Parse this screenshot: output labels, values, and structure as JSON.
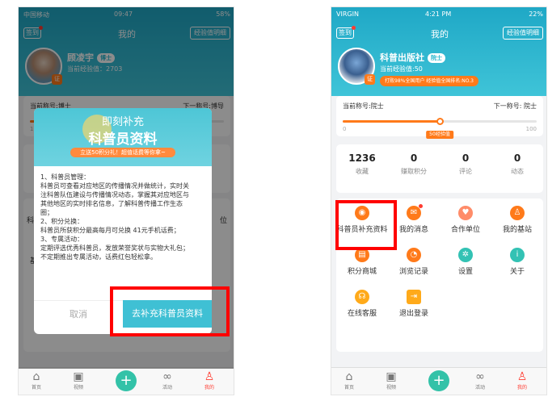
{
  "status": {
    "carrier_left": "中国移动",
    "time_left": "09:47",
    "battery_left": "58%",
    "carrier_right": "VIRGIN",
    "time_right": "4:21 PM",
    "battery_right": "22%"
  },
  "header": {
    "checkin_label": "签到",
    "title": "我的",
    "exp_detail_label": "经验值明细"
  },
  "left": {
    "user": {
      "name": "顾凌宇",
      "badge": "博士",
      "exp": "当前经验值：2703"
    },
    "level": {
      "current": "当前称号:博士",
      "next": "下一称号:博导",
      "min": "100"
    },
    "dialog": {
      "title1": "即刻补充",
      "title2": "科普员资料",
      "banner": "立送50积分礼！超值话费等你拿~",
      "lines": [
        "1、科普员管理：",
        "科普员可查看对应地区的传播情况并做统计，实时关",
        "注科普队伍建设与传播情况动态，掌握其对应地区与",
        "其他地区的实时排名信息，了解科普传播工作生态",
        "圈；",
        "2、积分兑换：",
        "科普员所获积分最高每月可兑换 41元手机话费；",
        "3、专属活动：",
        "定期评选优秀科普员，发放荣誉奖状与实物大礼包；",
        "不定期推出专属活动，话费红包轻松拿。"
      ],
      "cancel": "取消",
      "confirm": "去补充科普员资料"
    },
    "partial_left": "科普",
    "partial_left2": "基",
    "partial_right": "位"
  },
  "right": {
    "user": {
      "name": "科普出版社",
      "badge": "院士",
      "exp": "当前经验值:50",
      "rank": "打败98%全国用户 经验值全国排名:NO.3"
    },
    "level": {
      "current": "当前称号:院士",
      "next": "下一称号: 院士",
      "min": "0",
      "max": "100",
      "exp_badge": "50经验值",
      "progress": 0.5
    },
    "stats": [
      {
        "value": "1236",
        "label": "收藏"
      },
      {
        "value": "0",
        "label": "赚取积分"
      },
      {
        "value": "0",
        "label": "评论"
      },
      {
        "value": "0",
        "label": "动态"
      }
    ],
    "grid": [
      {
        "label": "科普员补充资料",
        "icon": "shield-icon",
        "color": "#ff7a1a"
      },
      {
        "label": "我的消息",
        "icon": "message-icon",
        "color": "#ff7a1a"
      },
      {
        "label": "合作单位",
        "icon": "handshake-icon",
        "color": "#ff8c69"
      },
      {
        "label": "我的基站",
        "icon": "person-icon",
        "color": "#ff7a1a"
      },
      {
        "label": "积分商城",
        "icon": "shop-icon",
        "color": "#ff7a1a"
      },
      {
        "label": "浏览记录",
        "icon": "history-icon",
        "color": "#ff7a1a"
      },
      {
        "label": "设置",
        "icon": "gear-icon",
        "color": "#33c2b4"
      },
      {
        "label": "关于",
        "icon": "info-icon",
        "color": "#33c2b4"
      },
      {
        "label": "在线客服",
        "icon": "headset-icon",
        "color": "#ffaa1a"
      },
      {
        "label": "退出登录",
        "icon": "logout-icon",
        "color": "#ffaa1a"
      }
    ]
  },
  "tabs": [
    {
      "label": "首页",
      "icon": "home-icon"
    },
    {
      "label": "视频",
      "icon": "video-icon"
    },
    {
      "label": "",
      "icon": "plus-icon"
    },
    {
      "label": "活动",
      "icon": "activity-icon"
    },
    {
      "label": "我的",
      "icon": "profile-icon"
    }
  ]
}
